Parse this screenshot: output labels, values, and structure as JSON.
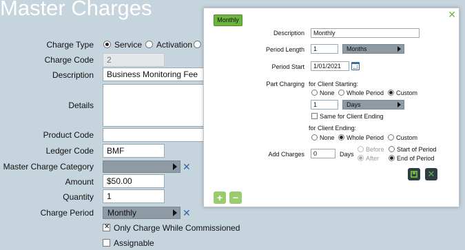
{
  "page": {
    "title": "Master Charges"
  },
  "form": {
    "charge_type": {
      "label": "Charge Type",
      "options": [
        "Service",
        "Activation"
      ],
      "selected": "Service"
    },
    "charge_code": {
      "label": "Charge Code",
      "value": "2"
    },
    "description": {
      "label": "Description",
      "value": "Business Monitoring Fee"
    },
    "details": {
      "label": "Details",
      "value": ""
    },
    "product_code": {
      "label": "Product Code",
      "value": ""
    },
    "ledger_code": {
      "label": "Ledger Code",
      "value": "BMF"
    },
    "master_charge_category": {
      "label": "Master Charge Category",
      "value": ""
    },
    "amount": {
      "label": "Amount",
      "value": "$50.00"
    },
    "quantity": {
      "label": "Quantity",
      "value": "1"
    },
    "charge_period": {
      "label": "Charge Period",
      "value": "Monthly"
    },
    "only_commissioned": {
      "label": "Only Charge While Commissioned",
      "checked": true
    },
    "assignable": {
      "label": "Assignable",
      "checked": false
    }
  },
  "modal": {
    "tab_label": "Monthly",
    "description": {
      "label": "Description",
      "value": "Monthly"
    },
    "period_length": {
      "label": "Period Length",
      "value": "1",
      "unit": "Months"
    },
    "period_start": {
      "label": "Period Start",
      "value": "1/01/2021"
    },
    "part_charging": {
      "label": "Part Charging",
      "starting_label": "for Client Starting:",
      "starting_options": [
        "None",
        "Whole Period",
        "Custom"
      ],
      "starting_selected": "Custom",
      "custom_value": "1",
      "custom_unit": "Days",
      "same_label": "Same for Client Ending",
      "same_checked": false,
      "ending_label": "for Client Ending:",
      "ending_options": [
        "None",
        "Whole Period",
        "Custom"
      ],
      "ending_selected": "Whole Period"
    },
    "add_charges": {
      "label": "Add Charges",
      "value": "0",
      "unit": "Days",
      "timing_options": [
        "Before",
        "After"
      ],
      "timing_selected": "After",
      "period_options": [
        "Start of Period",
        "End of Period"
      ],
      "period_selected": "End of Period"
    }
  },
  "colors": {
    "background": "#c6d4de",
    "accent_green": "#6db33f",
    "select_grey": "#8e9ba4",
    "clear_blue": "#2b6aa8"
  }
}
